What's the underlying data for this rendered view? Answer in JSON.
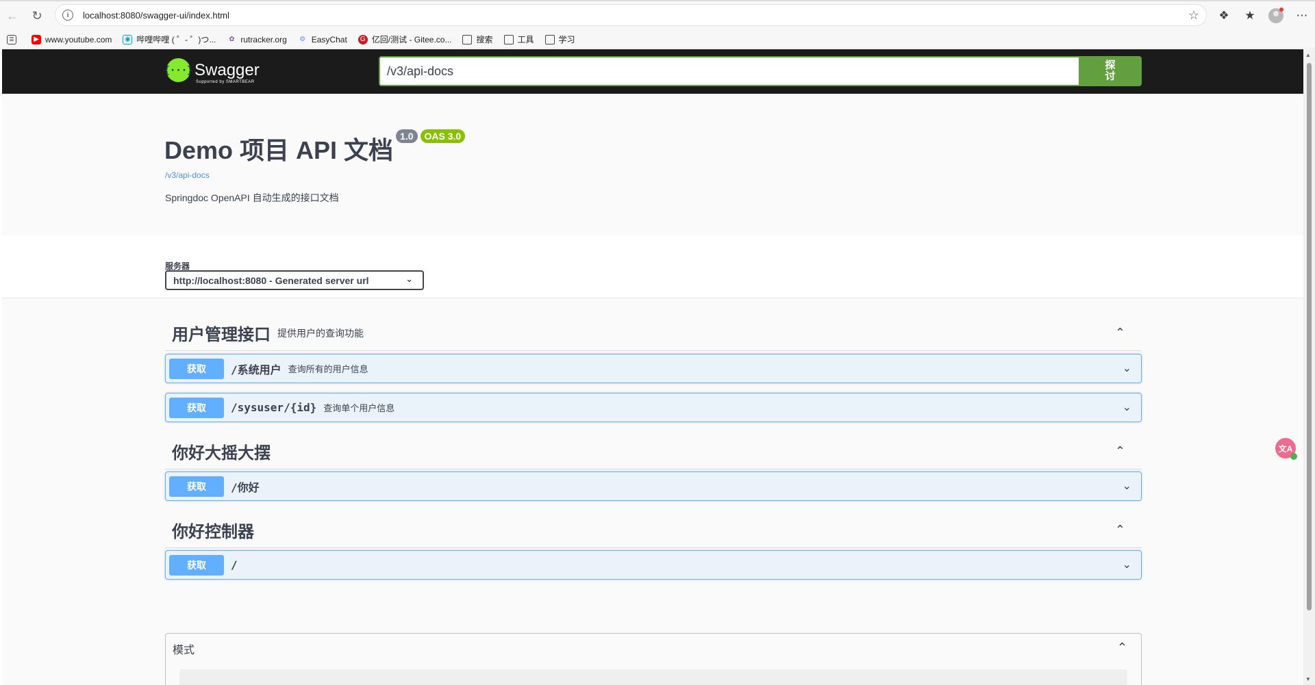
{
  "browser": {
    "url": "localhost:8080/swagger-ui/index.html"
  },
  "bookmarks": [
    {
      "label": "www.youtube.com",
      "icon": "youtube-icon",
      "color": "#ff0000"
    },
    {
      "label": "哔哩哔哩 ( ゜- ゜)つ...",
      "icon": "bilibili-icon",
      "color": "#00a1d6"
    },
    {
      "label": "rutracker.org",
      "icon": "rutracker-icon",
      "color": "#7e57c2"
    },
    {
      "label": "EasyChat",
      "icon": "easychat-icon",
      "color": "#5b8def"
    },
    {
      "label": "亿回/测试 - Gitee.co...",
      "icon": "gitee-icon",
      "color": "#c71d23"
    },
    {
      "label": "搜索",
      "icon": "folder-icon",
      "color": "#444444"
    },
    {
      "label": "工具",
      "icon": "folder-icon",
      "color": "#444444"
    },
    {
      "label": "学习",
      "icon": "folder-icon",
      "color": "#444444"
    }
  ],
  "swagger": {
    "logo_text": "Swagger",
    "logo_sub": "Supported by SMARTBEAR",
    "logo_glyph": "{···}",
    "explore_value": "/v3/api-docs",
    "explore_button": "探\n讨"
  },
  "info": {
    "title": "Demo 项目 API 文档",
    "version": "1.0",
    "oas": "OAS 3.0",
    "link": "/v3/api-docs",
    "description": "Springdoc OpenAPI 自动生成的接口文档"
  },
  "servers": {
    "label": "服务器",
    "selected": "http://localhost:8080 - Generated server url"
  },
  "tags": [
    {
      "name": "用户管理接口",
      "description": "提供用户的查询功能",
      "operations": [
        {
          "method": "获取",
          "path": "/系统用户",
          "summary": "查询所有的用户信息"
        },
        {
          "method": "获取",
          "path": "/sysuser/{id}",
          "summary": "查询单个用户信息"
        }
      ]
    },
    {
      "name": "你好大摇大摆",
      "description": "",
      "operations": [
        {
          "method": "获取",
          "path": "/你好",
          "summary": ""
        }
      ]
    },
    {
      "name": "你好控制器",
      "description": "",
      "operations": [
        {
          "method": "获取",
          "path": "/",
          "summary": ""
        }
      ]
    }
  ],
  "models": {
    "title": "模式"
  },
  "colors": {
    "get": "#61affe",
    "topbar": "#1b1b1b",
    "explore": "#62a03f",
    "oas_badge": "#89bf04",
    "version_badge": "#7d8492"
  }
}
